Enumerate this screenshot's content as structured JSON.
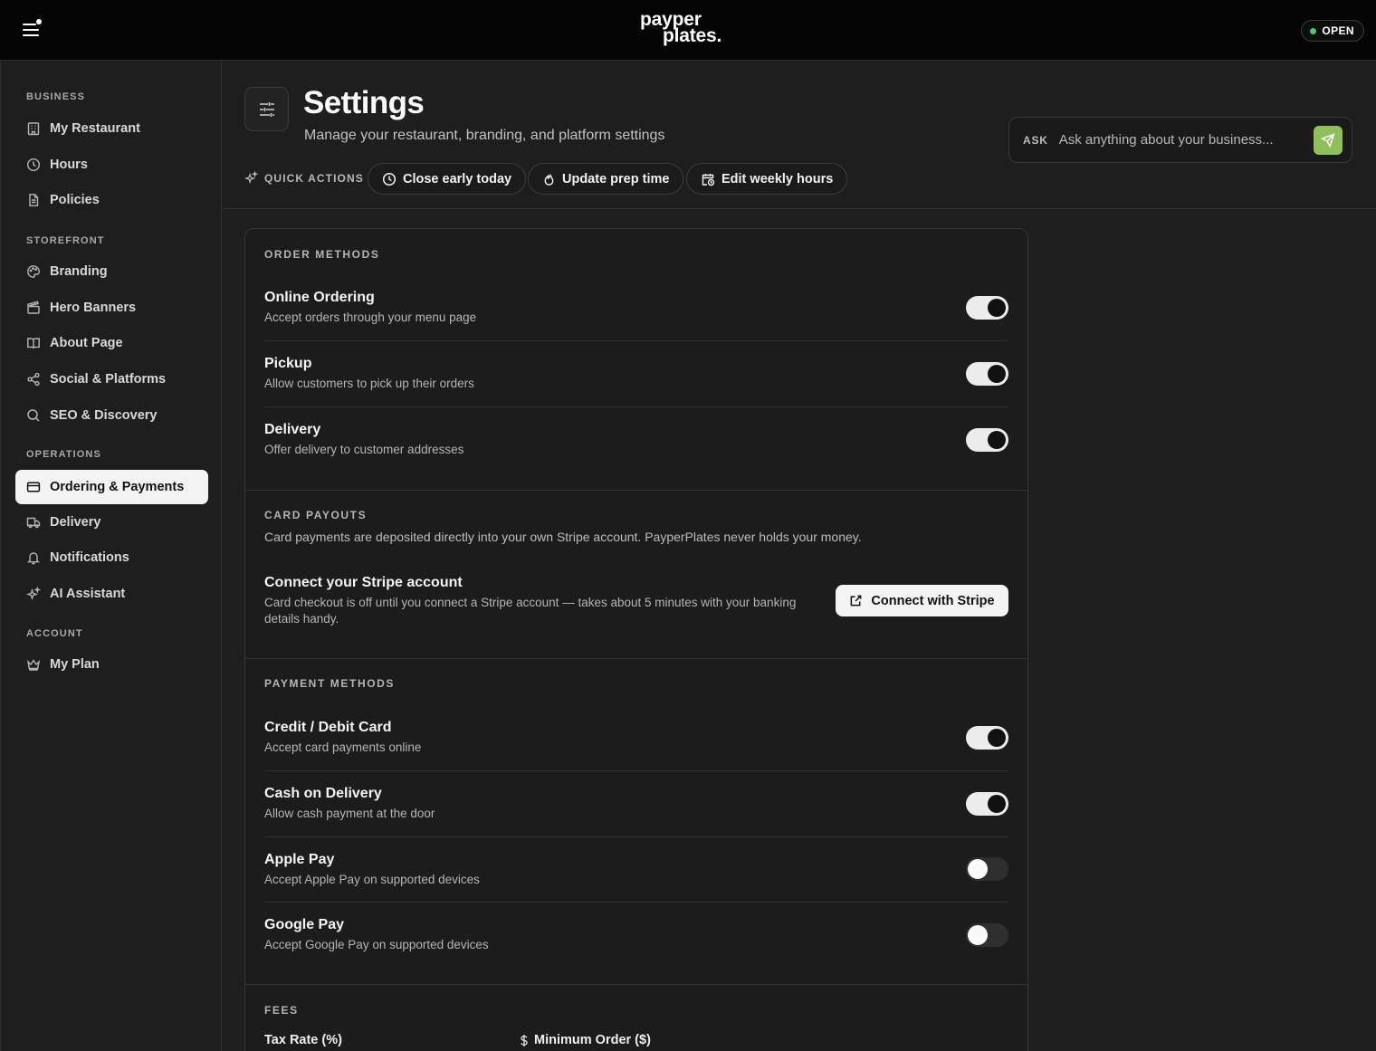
{
  "brand": {
    "logo_line1": "payper",
    "logo_line2": "plates."
  },
  "status": {
    "label": "OPEN",
    "color": "#3ad16b"
  },
  "sidebar": {
    "sections": [
      {
        "title": "BUSINESS",
        "items": [
          {
            "label": "My Restaurant",
            "icon": "building-icon"
          },
          {
            "label": "Hours",
            "icon": "clock-icon"
          },
          {
            "label": "Policies",
            "icon": "document-icon"
          }
        ]
      },
      {
        "title": "STOREFRONT",
        "items": [
          {
            "label": "Branding",
            "icon": "palette-icon"
          },
          {
            "label": "Hero Banners",
            "icon": "clapperboard-icon"
          },
          {
            "label": "About Page",
            "icon": "book-icon"
          },
          {
            "label": "Social & Platforms",
            "icon": "share-icon"
          },
          {
            "label": "SEO & Discovery",
            "icon": "search-icon"
          }
        ]
      },
      {
        "title": "OPERATIONS",
        "items": [
          {
            "label": "Ordering & Payments",
            "icon": "credit-card-icon",
            "active": true
          },
          {
            "label": "Delivery",
            "icon": "truck-icon"
          },
          {
            "label": "Notifications",
            "icon": "bell-icon"
          },
          {
            "label": "AI Assistant",
            "icon": "sparkles-icon"
          }
        ]
      },
      {
        "title": "ACCOUNT",
        "items": [
          {
            "label": "My Plan",
            "icon": "crown-icon"
          }
        ]
      }
    ]
  },
  "header": {
    "title": "Settings",
    "subtitle": "Manage your restaurant, branding, and platform settings",
    "quick_actions_label": "QUICK ACTIONS",
    "quick_actions": [
      {
        "label": "Close early today",
        "icon": "clock-icon"
      },
      {
        "label": "Update prep time",
        "icon": "flame-icon"
      },
      {
        "label": "Edit weekly hours",
        "icon": "calendar-clock-icon"
      }
    ]
  },
  "ask": {
    "label": "ASK",
    "placeholder": "Ask anything about your business...",
    "accent": "#8fbf5a"
  },
  "order_methods": {
    "title": "ORDER METHODS",
    "rows": [
      {
        "title": "Online Ordering",
        "desc": "Accept orders through your menu page",
        "enabled": true
      },
      {
        "title": "Pickup",
        "desc": "Allow customers to pick up their orders",
        "enabled": true
      },
      {
        "title": "Delivery",
        "desc": "Offer delivery to customer addresses",
        "enabled": true
      }
    ]
  },
  "card_payouts": {
    "title": "CARD PAYOUTS",
    "desc": "Card payments are deposited directly into your own Stripe account. PayperPlates never holds your money.",
    "stripe_title": "Connect your Stripe account",
    "stripe_desc": "Card checkout is off until you connect a Stripe account — takes about 5 minutes with your banking details handy.",
    "stripe_button": "Connect with Stripe"
  },
  "payment_methods": {
    "title": "PAYMENT METHODS",
    "rows": [
      {
        "title": "Credit / Debit Card",
        "desc": "Accept card payments online",
        "enabled": true
      },
      {
        "title": "Cash on Delivery",
        "desc": "Allow cash payment at the door",
        "enabled": true
      },
      {
        "title": "Apple Pay",
        "desc": "Accept Apple Pay on supported devices",
        "enabled": false
      },
      {
        "title": "Google Pay",
        "desc": "Accept Google Pay on supported devices",
        "enabled": false
      }
    ]
  },
  "fees": {
    "title": "FEES",
    "tax_label": "Tax Rate (%)",
    "min_order_label": "Minimum Order ($)"
  }
}
